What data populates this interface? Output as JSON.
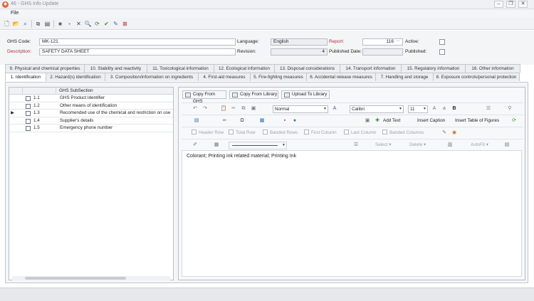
{
  "window": {
    "title": "46 - GHS Info Update"
  },
  "menu": {
    "file": "File"
  },
  "form": {
    "ghs_code_label": "GHS Code:",
    "ghs_code_value": "MK-121",
    "description_label": "Description:",
    "description_value": "SAFETY DATA SHEET",
    "language_label": "Language:",
    "language_value": "English",
    "revision_label": "Revision:",
    "revision_value": "4",
    "report_label": "Report:",
    "report_value": "116",
    "report_button": "···",
    "published_date_label": "Published Date:",
    "active_label": "Active:",
    "published_label": "Published:"
  },
  "tabs_top": [
    "9. Physical and chemical properties",
    "10. Stability and reactivity",
    "11. Toxicological information",
    "12. Ecological information",
    "13. Disposal considerations",
    "14. Transport information",
    "15. Regulatory information",
    "16. Other information"
  ],
  "tabs_bottom": [
    "1. Identification",
    "2. Hazard(s) identification",
    "3. Composition/information on ingredients",
    "4. First-aid measures",
    "5. Fire-fighting measures",
    "6. Accidental release measures",
    "7. Handling and storage",
    "8. Exposure controls/personal protection"
  ],
  "grid": {
    "header": "GHS SubSection",
    "rows": [
      {
        "num": "1.1",
        "text": "GHS Product Identifier"
      },
      {
        "num": "1.2",
        "text": "Other means of identification"
      },
      {
        "num": "1.3",
        "text": "Recomended use of the chemical and restriction on use"
      },
      {
        "num": "1.4",
        "text": "Supplier's details"
      },
      {
        "num": "1.5",
        "text": "Emergency phone number"
      }
    ]
  },
  "editor": {
    "copy_from_ghs": "Copy From GHS",
    "copy_from_library": "Copy From Library",
    "upload_to_library": "Upload To Library",
    "style_value": "Normal",
    "font_value": "Calibri",
    "size_value": "11",
    "bold_glyph": "B",
    "add_text": "Add Text",
    "insert_caption": "Insert Caption",
    "insert_table_of_figures": "Insert Table of Figures",
    "header_row": "Header Row",
    "total_row": "Total Row",
    "banded_rows": "Banded Rows",
    "first_column": "First Column",
    "last_column": "Last Column",
    "banded_columns": "Banded Columns",
    "select": "Select",
    "delete": "Delete",
    "autofit": "AutoFit",
    "content_text": "Colorant; Printing ink related material; Printing Ink"
  },
  "colors": {
    "accent": "#e0683a",
    "label_red": "#b03030"
  }
}
